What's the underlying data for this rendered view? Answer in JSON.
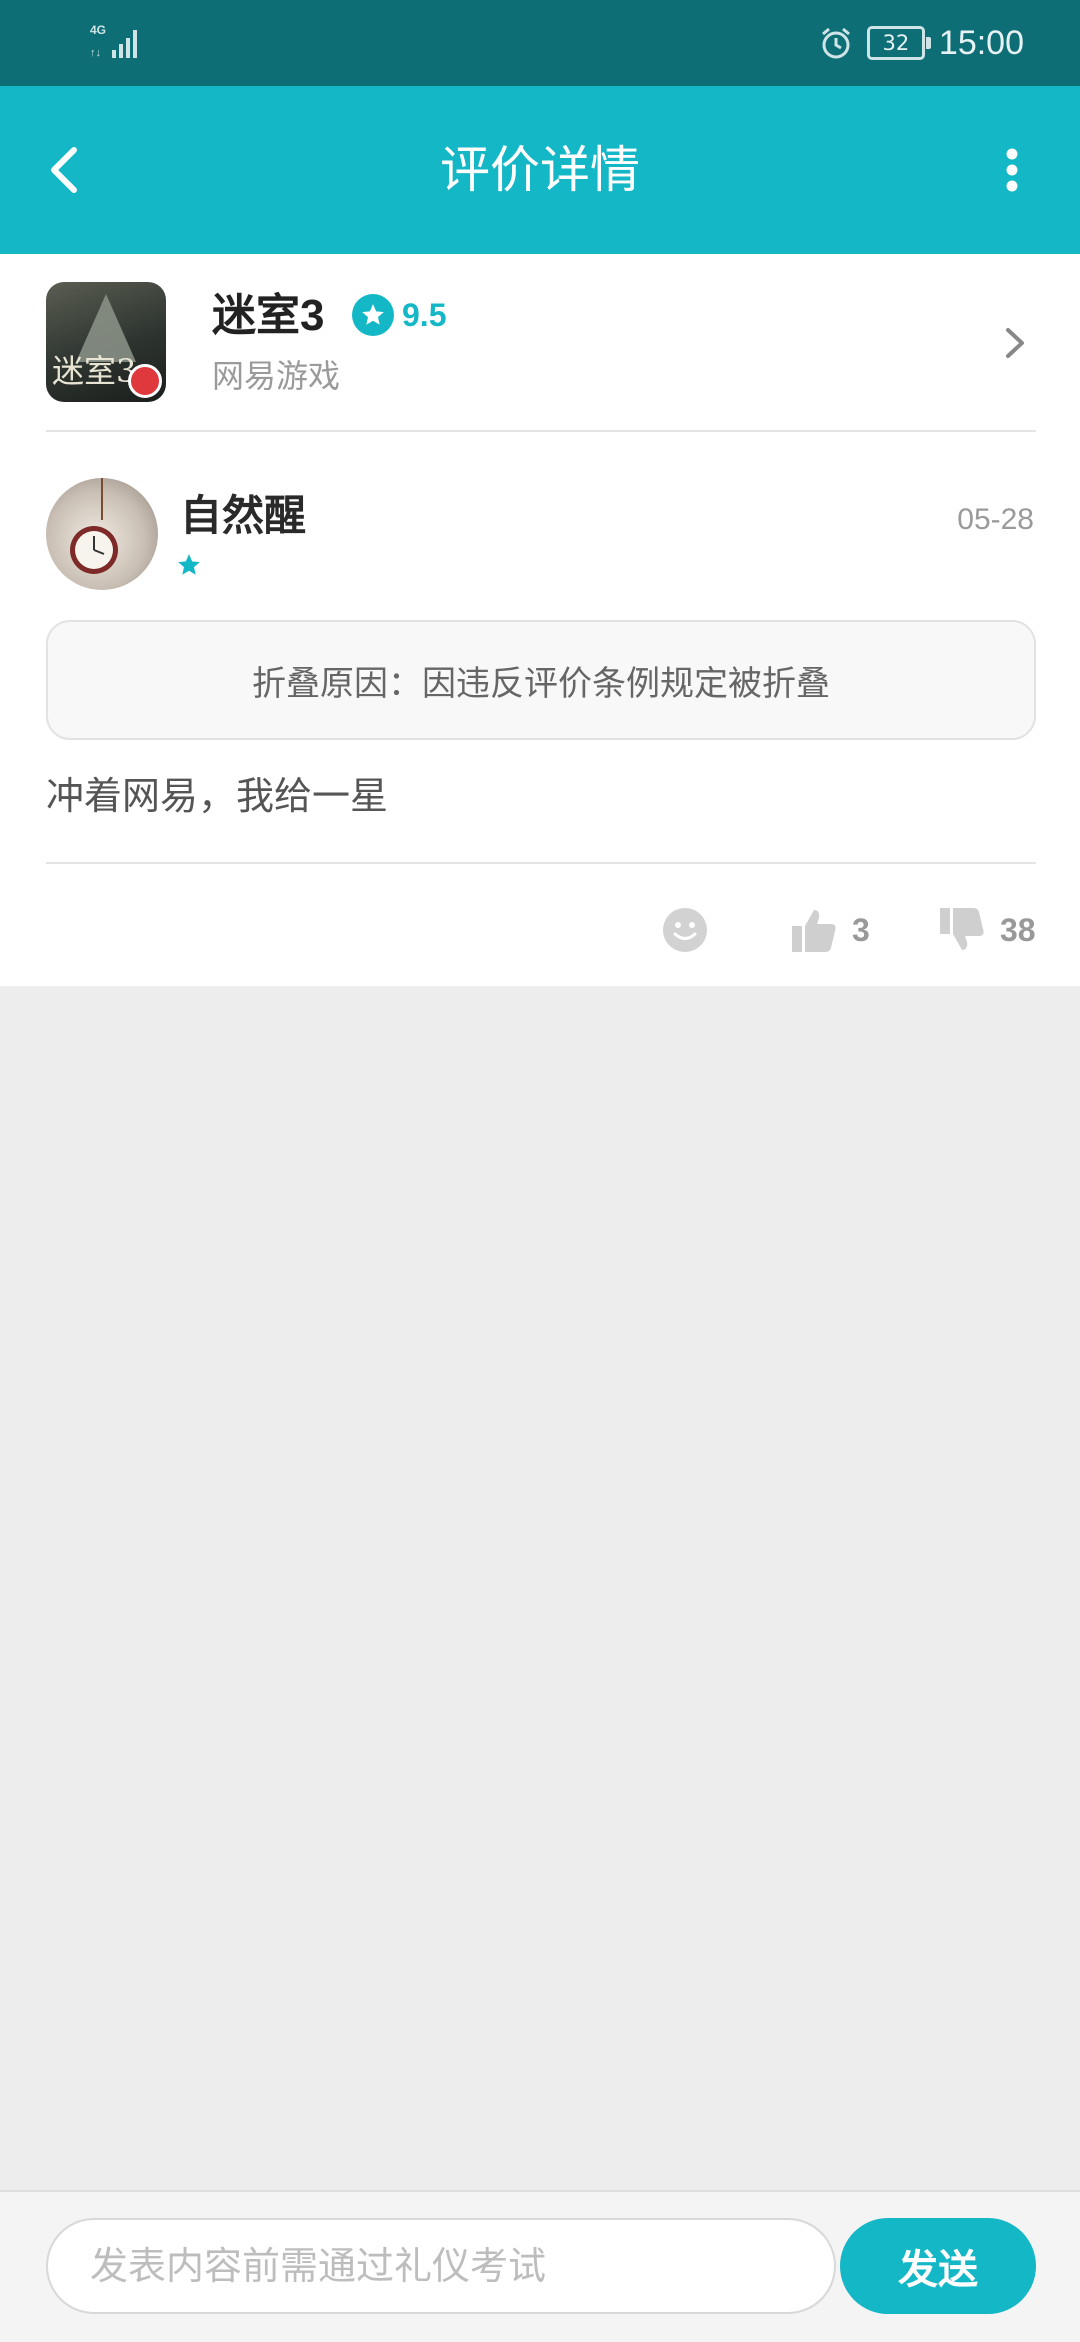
{
  "status_bar": {
    "network": "4G",
    "battery": "32",
    "time": "15:00",
    "alarm_icon": "alarm-clock-icon"
  },
  "header": {
    "title": "评价详情",
    "back_icon": "back-arrow-icon",
    "more_icon": "more-vertical-icon"
  },
  "game": {
    "name": "迷室3",
    "rating": "9.5",
    "publisher": "网易游戏",
    "icon_label": "迷室3"
  },
  "review": {
    "user_name": "自然醒",
    "date": "05-28",
    "fold_notice": "折叠原因：因违反评价条例规定被折叠",
    "content": "冲着网易，我给一星",
    "likes": "3",
    "dislikes": "38"
  },
  "composer": {
    "placeholder": "发表内容前需通过礼仪考试",
    "send_label": "发送"
  },
  "colors": {
    "accent": "#14b7c6",
    "status_bar": "#0e6e76"
  }
}
